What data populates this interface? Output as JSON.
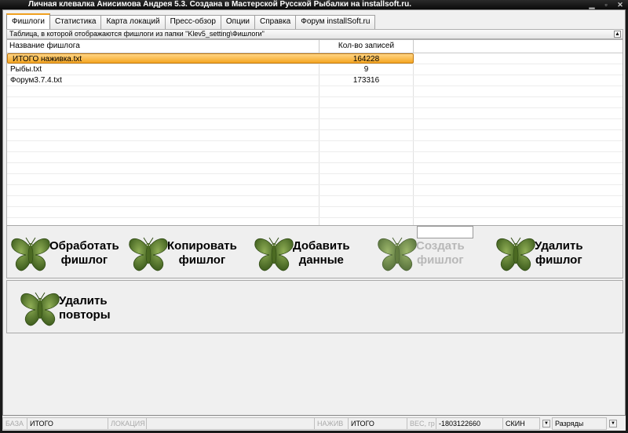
{
  "window": {
    "title": "Личная клевалка Анисимова Андрея 5.3. Создана в Мастерской Русской Рыбалки на installsoft.ru."
  },
  "tabs": [
    {
      "label": "Фишлоги",
      "active": true
    },
    {
      "label": "Статистика"
    },
    {
      "label": "Карта локаций"
    },
    {
      "label": "Пресс-обзор"
    },
    {
      "label": "Опции"
    },
    {
      "label": "Справка"
    },
    {
      "label": "Форум installSoft.ru"
    }
  ],
  "panel": {
    "caption": "Таблица, в которой отображаются фишлоги из папки \"Klev5_setting\\Фишлоги\""
  },
  "table": {
    "columns": [
      "Название фишлога",
      "Кол-во записей"
    ],
    "rows": [
      {
        "name": "ИТОГО наживка.txt",
        "count": "164228",
        "selected": true
      },
      {
        "name": "Рыбы.txt",
        "count": "9"
      },
      {
        "name": "Форум3.7.4.txt",
        "count": "173316"
      }
    ]
  },
  "buttons": {
    "process": "Обработать\nфишлог",
    "copy": "Копировать\nфишлог",
    "add": "Добавить\nданные",
    "create": "Создать\nфишлог",
    "delete": "Удалить\nфишлог",
    "dedupe": "Удалить\nповторы"
  },
  "status": {
    "base_label": "БАЗА",
    "base_value": "ИТОГО",
    "location_label": "ЛОКАЦИЯ",
    "bait_label": "НАЖИВ",
    "bait_value": "ИТОГО",
    "weight_label": "ВЕС, гр",
    "weight_value": "-1803122660",
    "skin_label": "СКИН",
    "digits_label": "Разряды"
  },
  "colors": {
    "selection": "#f5a623",
    "butterfly": "#5a7d2e",
    "accent_tab": "#f0a020"
  }
}
